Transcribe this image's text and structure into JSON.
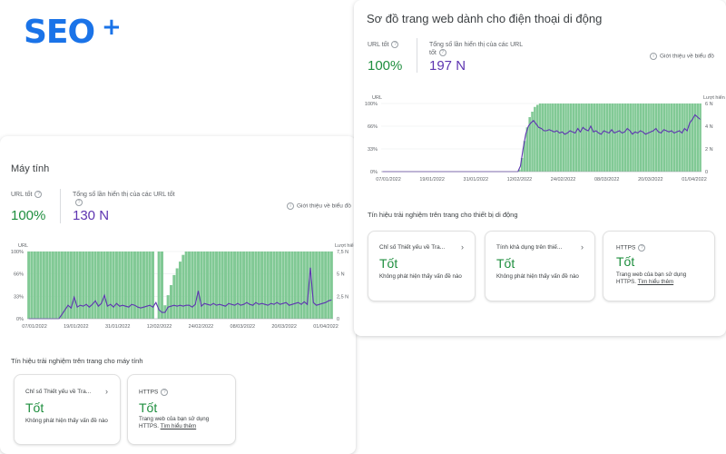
{
  "brand": {
    "logo_text": "SEO",
    "logo_plus": "+"
  },
  "desktop": {
    "title": "Máy tính",
    "good_url_label": "URL tốt",
    "good_url_value": "100%",
    "impressions_label": "Tổng số lần hiển thị của các URL tốt",
    "impressions_value": "130 N",
    "chart_intro": "Giới thiệu về biểu đồ",
    "signals_title": "Tín hiệu trải nghiệm trên trang cho máy tính",
    "cards": [
      {
        "title": "Chỉ số Thiết yếu về Tra...",
        "status": "Tốt",
        "desc": "Không phát hiện thấy vấn đề nào"
      },
      {
        "title": "HTTPS",
        "status": "Tốt",
        "desc": "Trang web của bạn sử dụng HTTPS.",
        "link": "Tìm hiểu thêm"
      }
    ]
  },
  "mobile": {
    "title": "Sơ đồ trang web dành cho điện thoại di động",
    "good_url_label": "URL tốt",
    "good_url_value": "100%",
    "impressions_label": "Tổng số lần hiển thị của các URL tốt",
    "impressions_value": "197 N",
    "chart_intro": "Giới thiệu về biểu đồ",
    "signals_title": "Tín hiệu trải nghiệm trên trang cho thiết bị di động",
    "cards": [
      {
        "title": "Chỉ số Thiết yếu về Tra...",
        "status": "Tốt",
        "desc": "Không phát hiện thấy vấn đề nào"
      },
      {
        "title": "Tính khả dụng trên thiế...",
        "status": "Tốt",
        "desc": "Không phát hiện thấy vấn đề nào"
      },
      {
        "title": "HTTPS",
        "status": "Tốt",
        "desc": "Trang web của bạn sử dụng HTTPS.",
        "link": "Tìm hiểu thêm"
      }
    ]
  },
  "colors": {
    "good": "#1e8e3e",
    "bar": "#81c995",
    "impressions_line": "#5e35b1",
    "accent": "#1a73e8"
  },
  "chart_data": [
    {
      "type": "bar",
      "ylabel": "URL",
      "y2label": "Lượt hiển thị",
      "y_ticks": [
        "100%",
        "66%",
        "33%",
        "0%"
      ],
      "y2_ticks": [
        "7,5 N",
        "5 N",
        "2,5 N",
        "0"
      ],
      "x_ticks": [
        "07/01/2022",
        "19/01/2022",
        "31/01/2022",
        "12/02/2022",
        "24/02/2022",
        "08/03/2022",
        "20/03/2022",
        "01/04/2022"
      ],
      "ylim": [
        0,
        100
      ],
      "y2lim": [
        0,
        7.5
      ],
      "grid": true,
      "series": [
        {
          "type": "bar",
          "axis": "left",
          "values": [
            100,
            100,
            100,
            100,
            100,
            100,
            100,
            100,
            100,
            100,
            100,
            100,
            100,
            100,
            100,
            100,
            100,
            100,
            100,
            100,
            100,
            100,
            100,
            100,
            100,
            100,
            100,
            100,
            100,
            100,
            100,
            100,
            100,
            100,
            100,
            100,
            100,
            100,
            100,
            100,
            100,
            100,
            0,
            100,
            100,
            20,
            35,
            50,
            65,
            75,
            85,
            95,
            100,
            100,
            100,
            100,
            100,
            100,
            100,
            100,
            100,
            100,
            100,
            100,
            100,
            100,
            100,
            100,
            100,
            100,
            100,
            100,
            100,
            100,
            100,
            100,
            100,
            100,
            100,
            100,
            100,
            100,
            100,
            100,
            100,
            100,
            100,
            100,
            100,
            100,
            100,
            100,
            100,
            100,
            100,
            100,
            100,
            100,
            100,
            100,
            100
          ]
        },
        {
          "type": "line",
          "axis": "right",
          "values": [
            0,
            0,
            0,
            0,
            0,
            0,
            0,
            0,
            0,
            0,
            0,
            0.5,
            1,
            1.5,
            1.2,
            2.4,
            1.3,
            1.5,
            1.4,
            1.6,
            1.3,
            1.6,
            2.0,
            1.4,
            1.7,
            2.6,
            1.4,
            1.6,
            1.3,
            1.7,
            1.4,
            1.5,
            1.4,
            1.3,
            1.6,
            1.5,
            1.3,
            1.2,
            1.3,
            1.4,
            1.5,
            1.3,
            1.8,
            1.0,
            0.7,
            0.7,
            1.3,
            1.4,
            1.5,
            1.4,
            1.5,
            1.4,
            1.5,
            1.5,
            1.3,
            1.6,
            3.1,
            1.4,
            1.7,
            1.6,
            1.5,
            1.7,
            1.5,
            1.6,
            1.5,
            1.4,
            1.7,
            1.6,
            1.5,
            1.7,
            1.5,
            1.6,
            1.8,
            1.6,
            1.5,
            1.8,
            1.6,
            1.7,
            1.6,
            1.5,
            1.7,
            1.6,
            1.8,
            1.6,
            1.7,
            1.8,
            1.5,
            1.6,
            1.7,
            1.8,
            1.6,
            1.9,
            1.6,
            5.7,
            1.8,
            1.5,
            1.6,
            1.7,
            1.8,
            2.0,
            2.1
          ]
        }
      ]
    },
    {
      "type": "bar",
      "ylabel": "URL",
      "y2label": "Lượt hiển thị",
      "y_ticks": [
        "100%",
        "66%",
        "33%",
        "0%"
      ],
      "y2_ticks": [
        "6 N",
        "4 N",
        "2 N",
        "0"
      ],
      "x_ticks": [
        "07/01/2022",
        "19/01/2022",
        "31/01/2022",
        "12/02/2022",
        "24/02/2022",
        "08/03/2022",
        "20/03/2022",
        "01/04/2022"
      ],
      "ylim": [
        0,
        100
      ],
      "y2lim": [
        0,
        6
      ],
      "grid": true,
      "series": [
        {
          "type": "bar",
          "axis": "left",
          "values": [
            0,
            0,
            0,
            0,
            0,
            0,
            0,
            0,
            0,
            0,
            0,
            0,
            0,
            0,
            0,
            0,
            0,
            0,
            0,
            0,
            0,
            0,
            0,
            0,
            0,
            0,
            0,
            0,
            0,
            0,
            0,
            0,
            0,
            0,
            0,
            0,
            0,
            0,
            0,
            0,
            0,
            0,
            0,
            0,
            0,
            0,
            0,
            0,
            0,
            0,
            0,
            0,
            0,
            3,
            20,
            45,
            65,
            80,
            88,
            95,
            98,
            100,
            100,
            100,
            100,
            100,
            100,
            100,
            100,
            100,
            100,
            100,
            100,
            100,
            100,
            100,
            100,
            100,
            100,
            100,
            100,
            100,
            100,
            100,
            100,
            100,
            100,
            100,
            100,
            100,
            100,
            100,
            100,
            100,
            100,
            100,
            100,
            100,
            100,
            100,
            100,
            100,
            100,
            100,
            100,
            100,
            100,
            100,
            100,
            100,
            100,
            100,
            100,
            100,
            100,
            100,
            100,
            100,
            100,
            100,
            100,
            100,
            100,
            100
          ]
        },
        {
          "type": "line",
          "axis": "right",
          "values": [
            0,
            0,
            0,
            0,
            0,
            0,
            0,
            0,
            0,
            0,
            0,
            0,
            0,
            0,
            0,
            0,
            0,
            0,
            0,
            0,
            0,
            0,
            0,
            0,
            0,
            0,
            0,
            0,
            0,
            0,
            0,
            0,
            0,
            0,
            0,
            0,
            0,
            0,
            0,
            0,
            0,
            0,
            0,
            0,
            0,
            0,
            0,
            0,
            0,
            0,
            0,
            0,
            0,
            0.5,
            2,
            3.3,
            4.0,
            4.3,
            4.5,
            4.2,
            3.9,
            3.8,
            3.6,
            3.6,
            3.7,
            3.6,
            3.5,
            3.6,
            3.4,
            3.5,
            3.3,
            3.4,
            3.6,
            3.5,
            3.4,
            3.8,
            3.5,
            3.9,
            3.7,
            3.6,
            4.0,
            3.5,
            3.6,
            3.4,
            3.3,
            3.6,
            3.5,
            3.4,
            3.7,
            3.4,
            3.5,
            3.6,
            3.4,
            3.5,
            3.8,
            3.6,
            3.3,
            3.5,
            3.4,
            3.6,
            3.5,
            3.3,
            3.4,
            3.5,
            3.6,
            3.8,
            3.5,
            3.4,
            3.7,
            3.6,
            3.5,
            3.6,
            3.4,
            3.5,
            3.6,
            3.4,
            3.8,
            3.6,
            4.3,
            4.6,
            5.0,
            4.8,
            4.6
          ]
        }
      ]
    }
  ]
}
